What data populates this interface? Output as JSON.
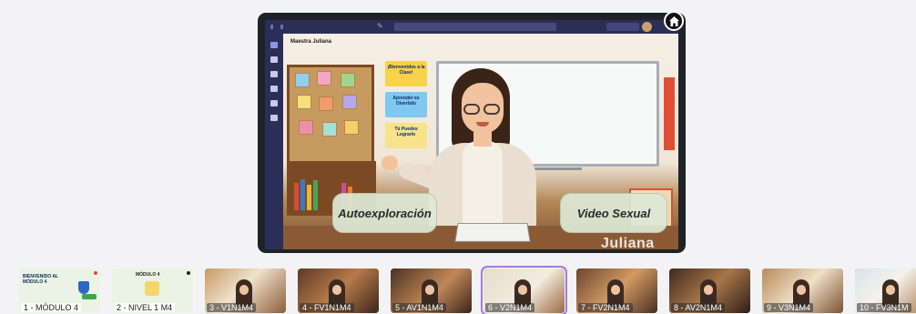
{
  "slide": {
    "room_title": "Maestra Juliana",
    "signs": [
      "¡Bienvenidos a la Clase!",
      "Aprender es Divertido",
      "Tú Puedes Lograrlo"
    ],
    "hotspots": {
      "left": "Autoexploración",
      "right": "Video Sexual"
    },
    "nameplate": "Juliana"
  },
  "home_icon": "home-icon",
  "thumbnails": [
    {
      "label": "1 - MÓDULO 4",
      "title": "BIENVENIDO AL MÓDULO 4",
      "style": "intro",
      "active": false
    },
    {
      "label": "2 - NIVEL 1 M4",
      "title": "MÓDULO 4",
      "style": "light",
      "active": false
    },
    {
      "label": "3 - V1N1M4",
      "style": "scene",
      "active": false
    },
    {
      "label": "4 - FV1N1M4",
      "style": "scene",
      "active": false
    },
    {
      "label": "5 - AV1N1M4",
      "style": "scene",
      "active": false
    },
    {
      "label": "6 - V2N1M4",
      "style": "scene",
      "active": true
    },
    {
      "label": "7 - FV2N1M4",
      "style": "scene",
      "active": false
    },
    {
      "label": "8 - AV2N1M4",
      "style": "scene",
      "active": false
    },
    {
      "label": "9 - V3N1M4",
      "style": "scene",
      "active": false
    },
    {
      "label": "10 - FV3N1M",
      "style": "scene",
      "active": false
    }
  ]
}
